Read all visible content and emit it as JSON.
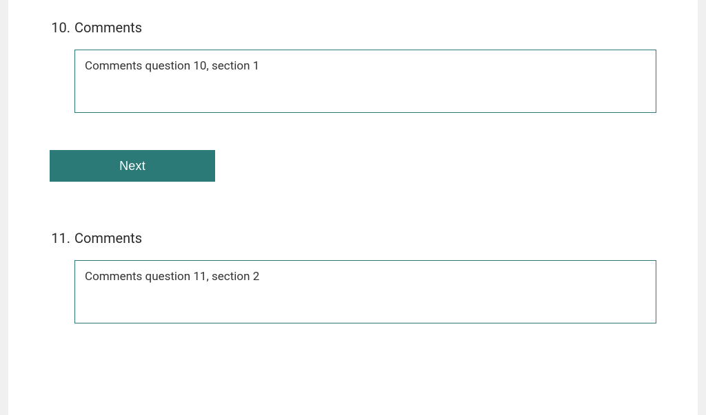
{
  "questions": {
    "q10": {
      "number": "10.",
      "title": "Comments",
      "value": "Comments question 10, section 1"
    },
    "q11": {
      "number": "11.",
      "title": "Comments",
      "value": "Comments question 11, section 2"
    }
  },
  "buttons": {
    "next": "Next"
  },
  "colors": {
    "accent": "#2b7a78"
  }
}
